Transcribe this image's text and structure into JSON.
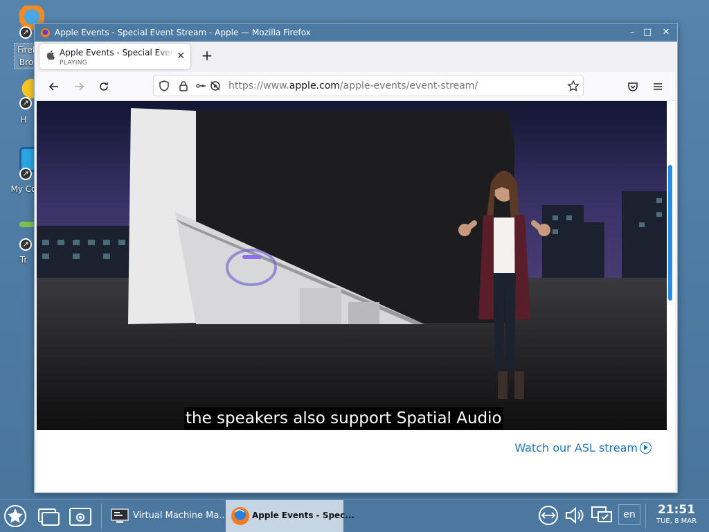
{
  "desktop": {
    "icons": [
      {
        "label": "Firef\nBro"
      },
      {
        "label": "H"
      },
      {
        "label": "My Co"
      },
      {
        "label": "Tr"
      }
    ]
  },
  "window": {
    "title": "Apple Events - Special Event Stream - Apple — Mozilla Firefox",
    "controls": {
      "minimize": "–",
      "maximize": "□",
      "close": "✕"
    }
  },
  "tab": {
    "title": "Apple Events - Special Event Stream - Apple",
    "status": "PLAYING",
    "close": "✕",
    "new_tab": "+"
  },
  "urlbar": {
    "url_prefix": "https://www.",
    "url_domain": "apple.com",
    "url_path": "/apple-events/event-stream/"
  },
  "page": {
    "caption": "the speakers also support Spatial Audio",
    "asl_link": "Watch our ASL stream"
  },
  "taskbar": {
    "tasks": [
      {
        "label": "Virtual Machine Ma..."
      },
      {
        "label": "Apple Events - Spec..."
      }
    ],
    "language": "en",
    "time": "21:51",
    "date": "TUE, 8 MAR"
  },
  "colors": {
    "accent": "#1d72b8",
    "titlebar": "#4d7aa2",
    "taskbar": "#4c78a0"
  }
}
